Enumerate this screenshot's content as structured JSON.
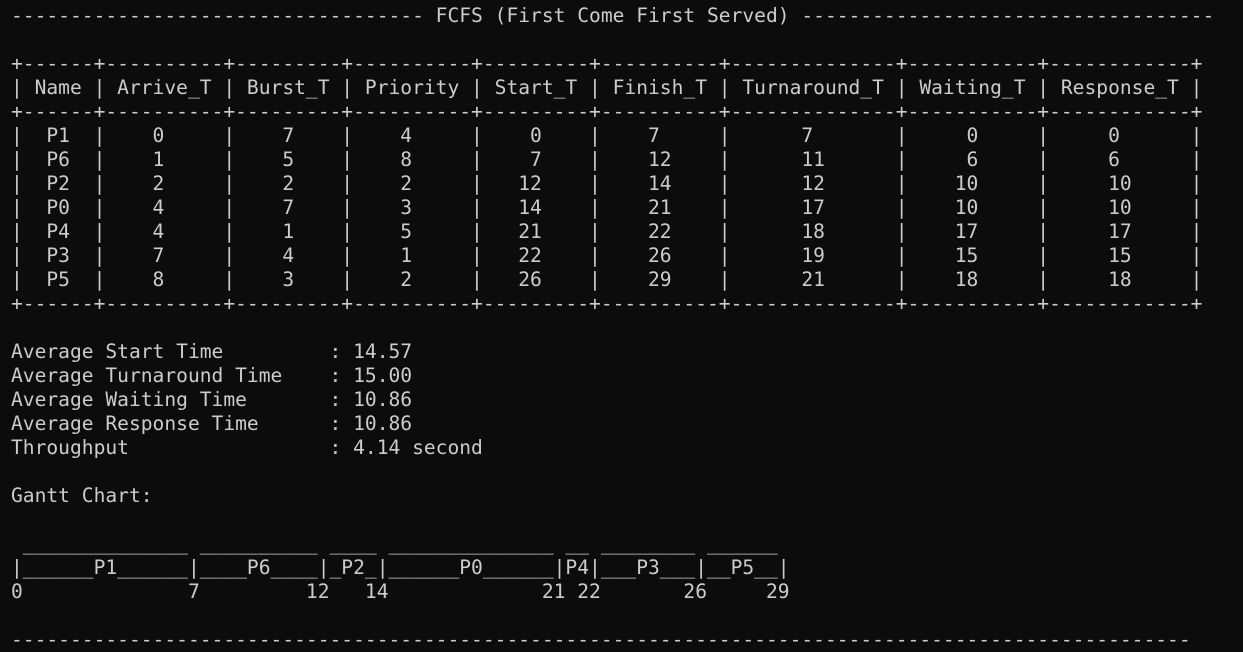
{
  "window": {
    "title_line": "----------------------------------- FCFS (First Come First Served) -----------------------------------"
  },
  "table": {
    "border": "+------+----------+---------+----------+---------+----------+--------------+-----------+------------+",
    "header": "| Name | Arrive_T | Burst_T | Priority | Start_T | Finish_T | Turnaround_T | Waiting_T | Response_T |",
    "columns": [
      "Name",
      "Arrive_T",
      "Burst_T",
      "Priority",
      "Start_T",
      "Finish_T",
      "Turnaround_T",
      "Waiting_T",
      "Response_T"
    ],
    "rows": [
      "|  P1  |    0     |    7    |    4     |    0    |    7     |      7       |     0     |     0      |",
      "|  P6  |    1     |    5    |    8     |    7    |    12    |      11      |     6     |     6      |",
      "|  P2  |    2     |    2    |    2     |   12    |    14    |      12      |    10     |     10     |",
      "|  P0  |    4     |    7    |    3     |   14    |    21    |      17      |    10     |     10     |",
      "|  P4  |    4     |    1    |    5     |   21    |    22    |      18      |    17     |     17     |",
      "|  P3  |    7     |    4    |    1     |   22    |    26    |      19      |    15     |     15     |",
      "|  P5  |    8     |    3    |    2     |   26    |    29    |      21      |    18     |     18     |"
    ]
  },
  "stats": [
    "Average Start Time         : 14.57",
    "Average Turnaround Time    : 15.00",
    "Average Waiting Time       : 10.86",
    "Average Response Time      : 10.86",
    "Throughput                 : 4.14 second"
  ],
  "gantt": {
    "title": "Gantt Chart:",
    "top": " ______________ __________ ____ ______________ __ ________ ______",
    "bars": "|______P1______|____P6____|_P2_|______P0______|P4|___P3___|__P5__|",
    "times": "0              7         12   14             21 22       26     29"
  },
  "footer_line": "----------------------------------------------------------------------------------------------------",
  "colors": {
    "background": "#0c0c0c",
    "text": "#cccccc"
  }
}
